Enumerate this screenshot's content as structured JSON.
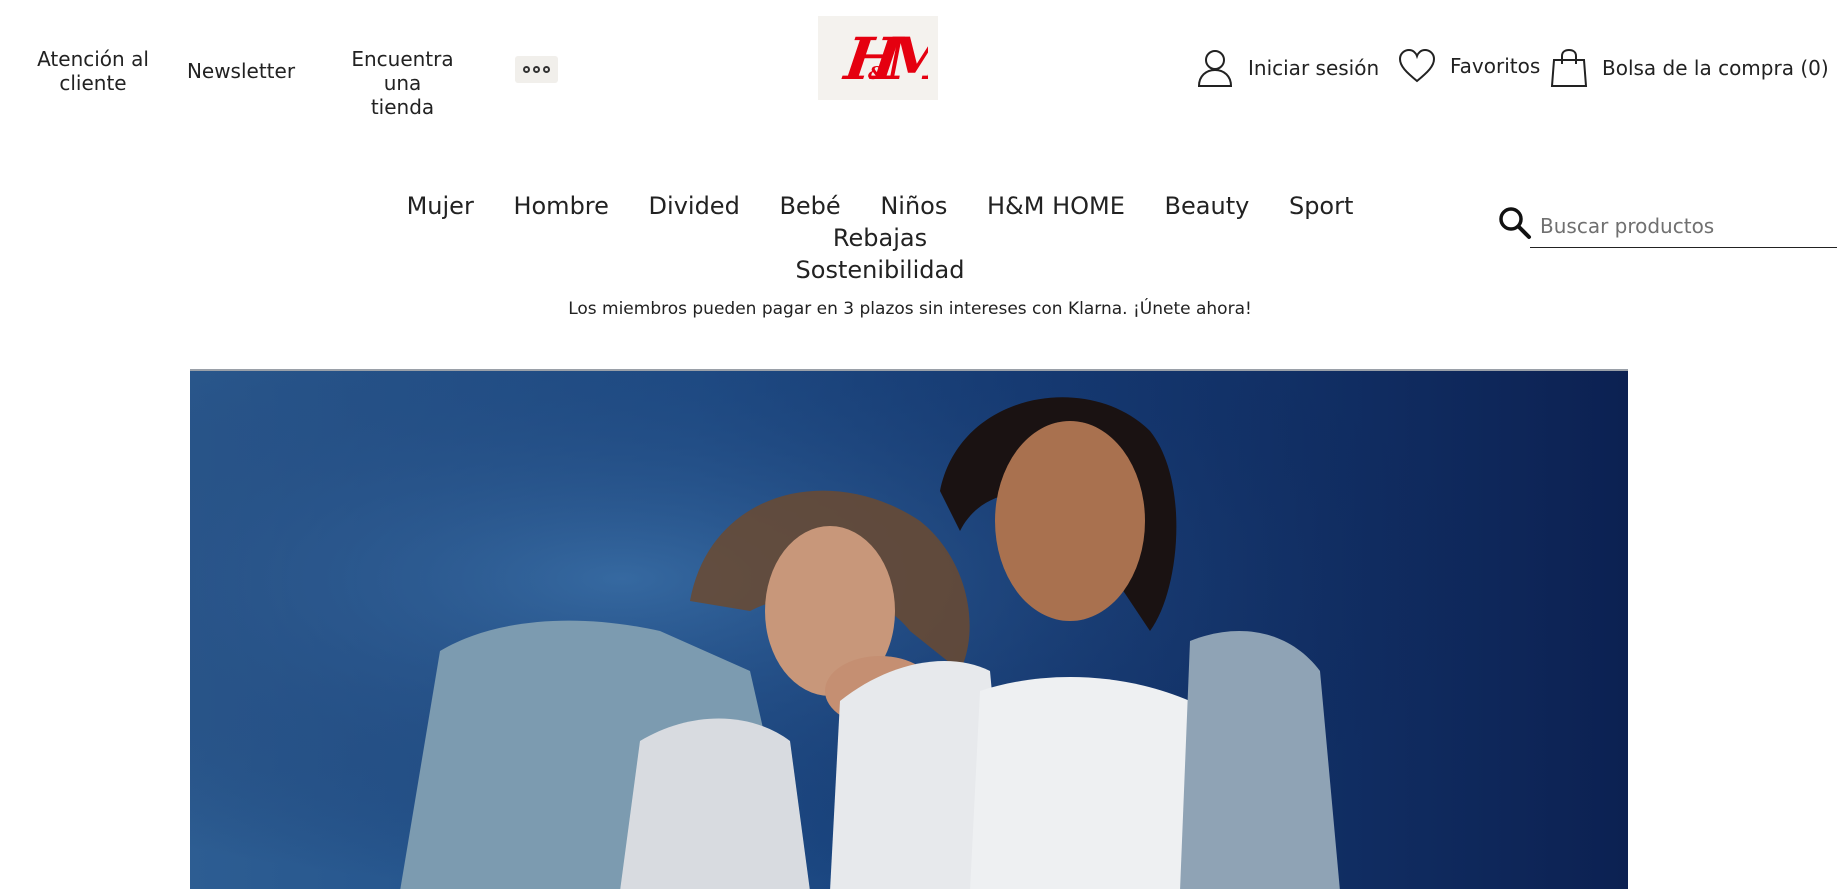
{
  "brand": {
    "logo_text": "H&M",
    "logo_color": "#e50010"
  },
  "utility_nav": {
    "customer_service": "Atención al\ncliente",
    "newsletter": "Newsletter",
    "find_store": "Encuentra una\ntienda",
    "more_icon": "more-dots-icon"
  },
  "account": {
    "login_label": "Iniciar sesión",
    "login_icon": "user-icon",
    "favorites_label": "Favoritos",
    "favorites_icon": "heart-icon",
    "bag_label": "Bolsa de la compra (0)",
    "bag_icon": "shopping-bag-icon"
  },
  "main_nav": {
    "items": [
      {
        "label": "Mujer"
      },
      {
        "label": "Hombre"
      },
      {
        "label": "Divided"
      },
      {
        "label": "Bebé"
      },
      {
        "label": "Niños"
      },
      {
        "label": "H&M HOME"
      },
      {
        "label": "Beauty"
      },
      {
        "label": "Sport"
      },
      {
        "label": "Rebajas"
      },
      {
        "label": "Sostenibilidad"
      }
    ]
  },
  "search": {
    "placeholder": "Buscar productos",
    "value": "",
    "icon": "search-icon"
  },
  "promo": {
    "text": "Los miembros pueden pagar en 3 plazos sin intereses con Klarna. ¡Únete ahora!"
  },
  "hero": {
    "background_color": "#1f4f8a"
  }
}
